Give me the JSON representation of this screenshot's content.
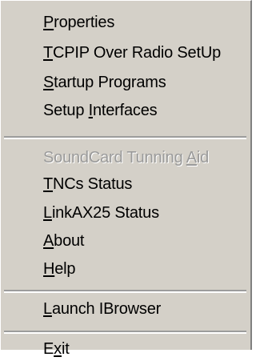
{
  "menu": {
    "items": [
      {
        "label": "Properties",
        "mnemonic": "P",
        "enabled": true
      },
      {
        "label": "TCPIP Over Radio SetUp",
        "mnemonic": "T",
        "enabled": true
      },
      {
        "label": "Startup Programs",
        "mnemonic": "S",
        "enabled": true
      },
      {
        "label": "Setup Interfaces",
        "mnemonic": "I",
        "enabled": true
      },
      {
        "label": "SoundCard Tunning Aid",
        "mnemonic": "A",
        "enabled": false
      },
      {
        "label": "TNCs Status",
        "mnemonic": "T",
        "enabled": true
      },
      {
        "label": "LinkAX25 Status",
        "mnemonic": "L",
        "enabled": true
      },
      {
        "label": "About",
        "mnemonic": "A",
        "enabled": true
      },
      {
        "label": "Help",
        "mnemonic": "H",
        "enabled": true
      },
      {
        "label": "Launch IBrowser",
        "mnemonic": "L",
        "enabled": true
      },
      {
        "label": "Exit",
        "mnemonic": "x",
        "enabled": true
      }
    ]
  },
  "colors": {
    "menu_background": "#d4d0c8",
    "disabled_text": "#9a9a9a"
  }
}
